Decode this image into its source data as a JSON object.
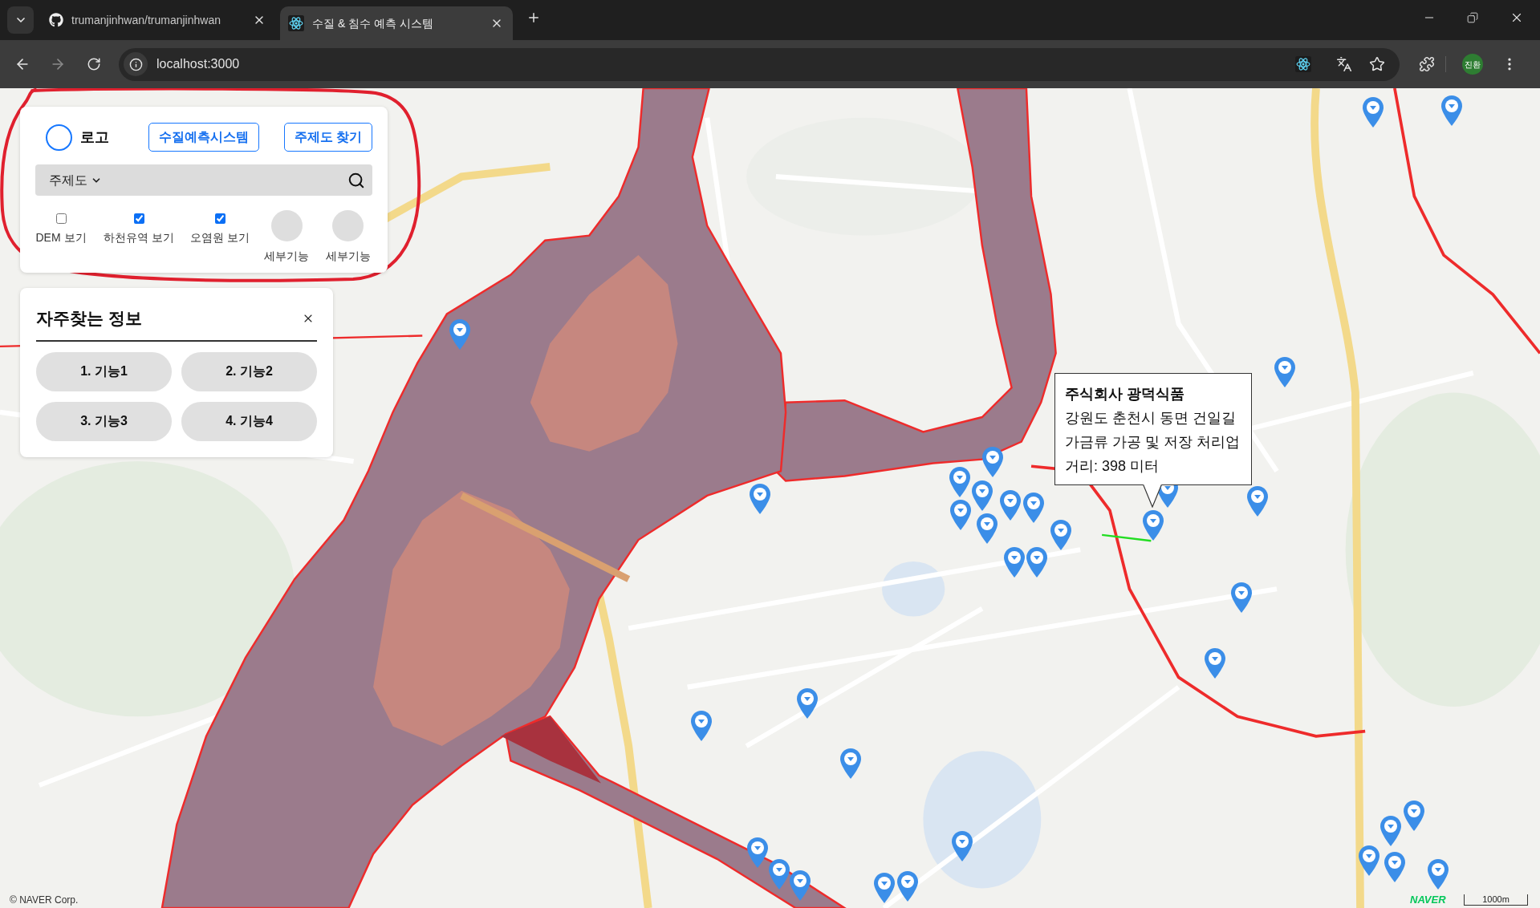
{
  "browser": {
    "tabs": [
      {
        "title": "trumanjinhwan/trumanjinhwan",
        "selected": false
      },
      {
        "title": "수질 & 침수 예측 시스템",
        "selected": true
      }
    ],
    "address": "localhost:3000",
    "profile": "진환"
  },
  "control_panel": {
    "logo": "로고",
    "buttons": [
      "수질예측시스템",
      "주제도 찾기"
    ],
    "search": {
      "dropdown": "주제도"
    },
    "toggles": [
      {
        "kind": "checkbox",
        "label": "DEM 보기",
        "checked": false
      },
      {
        "kind": "checkbox",
        "label": "하천유역 보기",
        "checked": true
      },
      {
        "kind": "checkbox",
        "label": "오염원 보기",
        "checked": true
      },
      {
        "kind": "circle",
        "label": "세부기능"
      },
      {
        "kind": "circle",
        "label": "세부기능"
      }
    ]
  },
  "favorites_panel": {
    "title": "자주찾는 정보",
    "items": [
      "1. 기능1",
      "2. 기능2",
      "3. 기능3",
      "4. 기능4"
    ]
  },
  "map": {
    "popup": {
      "title": "주식회사 광덕식품",
      "lines": [
        "강원도 춘천시 동면 건일길",
        "가금류 가공 및 저장 처리업",
        "거리: 398 미터"
      ]
    },
    "attribution": "© NAVER Corp.",
    "logo": "NAVER",
    "scale": "1000m"
  }
}
